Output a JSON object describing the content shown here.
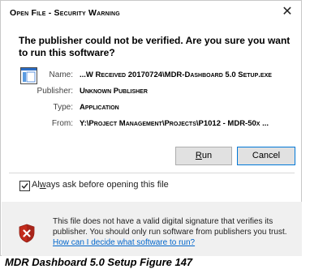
{
  "dialog": {
    "title": "Open File - Security Warning",
    "close_glyph": "✕",
    "headline": "The publisher could not be verified.  Are you sure you want to run this software?"
  },
  "file_info": {
    "name_label": "Name:",
    "name_value": "...W Received 20170724\\MDR-Dashboard 5.0 Setup.exe",
    "publisher_label": "Publisher:",
    "publisher_value": "Unknown Publisher",
    "type_label": "Type:",
    "type_value": "Application",
    "from_label": "From:",
    "from_value": "Y:\\Project Management\\Projects\\P1012 - MDR-50x ..."
  },
  "buttons": {
    "run_prefix": "",
    "run_mnemonic": "R",
    "run_rest": "un",
    "cancel": "Cancel"
  },
  "checkbox": {
    "label_prefix": "Al",
    "label_mnemonic": "w",
    "label_rest": "ays ask before opening this file",
    "checked": true
  },
  "warning": {
    "text": "This file does not have a valid digital signature that verifies its publisher.  You should only run software from publishers you trust.",
    "link": "How can I decide what software to run?"
  },
  "caption": "MDR Dashboard 5.0 Setup Figure 147",
  "colors": {
    "link": "#0066cc",
    "shield_red": "#c42b1c",
    "panel_bg": "#f0f0f0"
  }
}
